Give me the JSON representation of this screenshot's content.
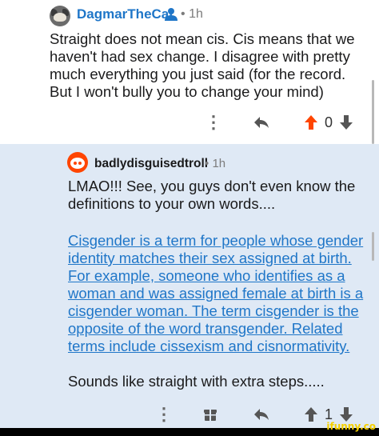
{
  "parent_comment": {
    "username": "DagmarTheCat",
    "separator": "•",
    "age": "1h",
    "body": "Straight does not mean cis. Cis means that we haven't had sex change. I disagree with pretty much everything you just said (for the record. But I won't bully you to change your mind)",
    "score": "0"
  },
  "reply_comment": {
    "username": "badlydisguisedtroll",
    "separator": "•",
    "age": "1h",
    "text_intro": "LMAO!!! See, you guys don't even know the definitions to your own words....",
    "quoted_link": "Cisgender is a term for people whose gender identity matches their sex assigned at birth. For example, someone who identifies as a woman and was assigned female at birth is a cisgender woman. The term cisgender is the opposite of the word transgender. Related terms include cissexism and cisnormativity.",
    "text_outro": "Sounds like straight with extra steps.....",
    "score": "1"
  },
  "watermark": "ifunny.co",
  "colors": {
    "username_blue": "#1f76c8",
    "upvote_orange": "#ff4500",
    "reply_background": "#dfe9f5"
  },
  "icons": {
    "more": "⋮",
    "reply": "↶",
    "upvote": "arrow-up",
    "downvote": "arrow-down",
    "award": "gift-icon"
  }
}
